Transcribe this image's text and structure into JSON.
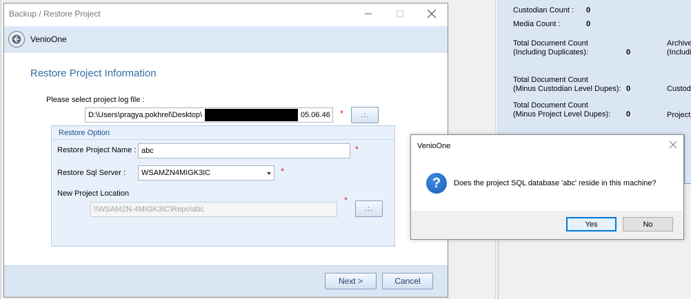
{
  "background": {
    "custodian_count_label": "Custodian Count :",
    "custodian_count_value": "0",
    "media_count_label": "Media Count :",
    "media_count_value": "0",
    "total_incl_dup_label_1": "Total Document Count",
    "total_incl_dup_label_2": "(Including Duplicates):",
    "total_incl_dup_value": "0",
    "archive_label_1": "Archive",
    "archive_label_2": "(Includi",
    "total_minus_cust_label_1": "Total Document Count",
    "total_minus_cust_label_2": "(Minus Custodian Level Dupes):",
    "total_minus_cust_value": "0",
    "custodi_label": "Custodi",
    "total_minus_proj_label_1": "Total Document Count",
    "total_minus_proj_label_2": "(Minus Project Level Dupes):",
    "total_minus_proj_value": "0",
    "project_label": "Project"
  },
  "dialog": {
    "title": "Backup / Restore Project",
    "app_name": "VenioOne",
    "section_title": "Restore Project Information",
    "log_file_label": "Please select project log file :",
    "log_file_value_prefix": "D:\\Users\\pragya.pokhrel\\Desktop\\",
    "log_file_value_suffix": "05.06.46",
    "browse_label": ".:.",
    "group_title": "Restore Option",
    "project_name_label": "Restore Project Name :",
    "project_name_value": "abc",
    "sql_server_label": "Restore Sql Server :",
    "sql_server_value": "WSAMZN4MIGK3IC",
    "location_label": "New Project Location",
    "location_value": "\\\\WSAMZN-4MIGK3IC\\Repo\\abc",
    "required_mark": "*",
    "next_label": "Next >",
    "cancel_label": "Cancel"
  },
  "msgbox": {
    "title": "VenioOne",
    "message": "Does the project SQL database 'abc' reside in this machine?",
    "yes_label": "Yes",
    "no_label": "No",
    "icon": "question-icon"
  },
  "colors": {
    "accent_title": "#2f6ea7",
    "panel_blue": "#dbe6f4",
    "required": "#d22222"
  }
}
